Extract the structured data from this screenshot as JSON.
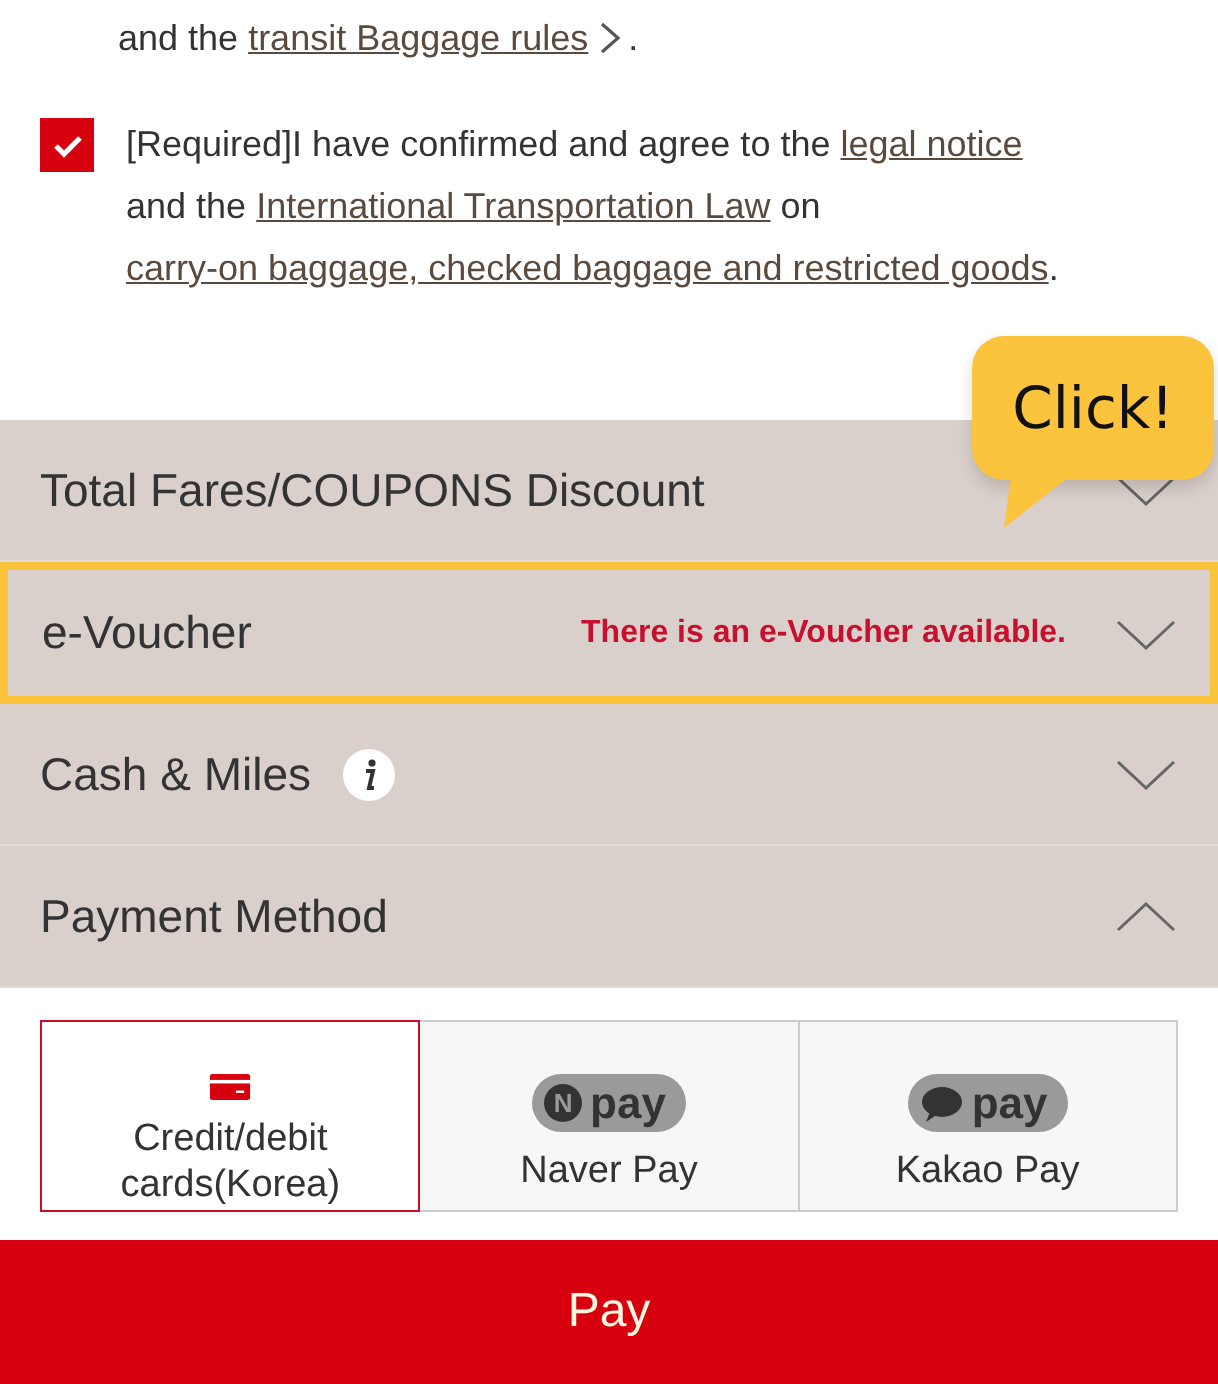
{
  "notice": [
    {
      "kind": "text",
      "text": "and the "
    },
    {
      "kind": "link",
      "text": "transit Baggage rules"
    },
    {
      "kind": "chevron"
    },
    {
      "kind": "text",
      "text": "."
    }
  ],
  "agreement": {
    "checked": true,
    "parts": [
      {
        "kind": "text",
        "text": "[Required]I have confirmed and agree to the "
      },
      {
        "kind": "link",
        "text": "legal notice"
      },
      {
        "kind": "break"
      },
      {
        "kind": "text",
        "text": "and the "
      },
      {
        "kind": "link",
        "text": "International Transportation Law"
      },
      {
        "kind": "text",
        "text": " on"
      },
      {
        "kind": "break"
      },
      {
        "kind": "link",
        "text": "carry-on baggage, checked baggage and restricted goods"
      },
      {
        "kind": "text",
        "text": "."
      }
    ]
  },
  "sections": [
    {
      "title": "Total Fares/COUPONS Discount",
      "expanded": false,
      "highlighted": false,
      "info": false
    },
    {
      "title": "e-Voucher",
      "message": "There is an e-Voucher available.",
      "expanded": false,
      "highlighted": true,
      "info": false
    },
    {
      "title": "Cash & Miles",
      "expanded": false,
      "highlighted": false,
      "info": true
    },
    {
      "title": "Payment Method",
      "expanded": true,
      "highlighted": false,
      "info": false
    }
  ],
  "payment_methods": [
    {
      "kind": "card",
      "label": "Credit/debit cards(Korea)",
      "selected": true
    },
    {
      "kind": "naver",
      "badge_mark": "N",
      "badge": "pay",
      "label": "Naver Pay",
      "selected": false
    },
    {
      "kind": "kakao",
      "badge": "pay",
      "label": "Kakao Pay",
      "selected": false
    }
  ],
  "tooltip": {
    "text": "Click!"
  },
  "pay_button": "Pay"
}
